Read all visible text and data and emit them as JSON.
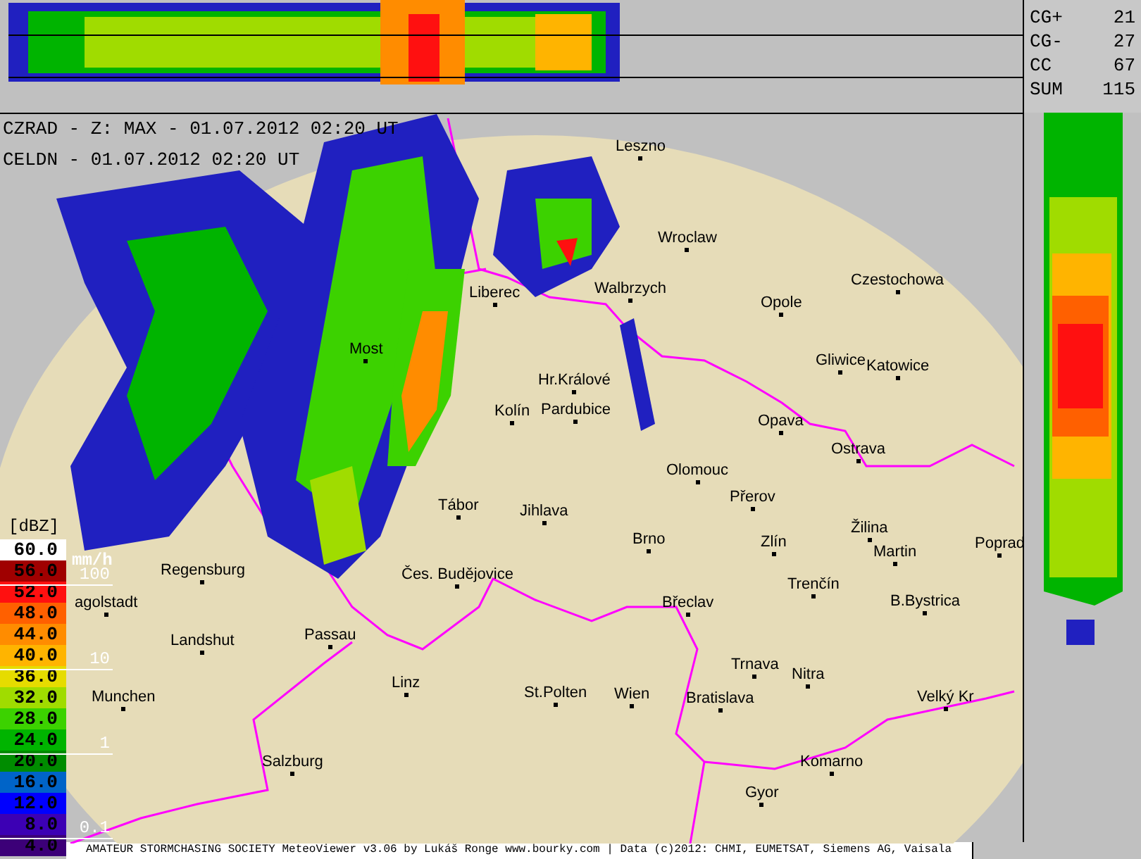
{
  "header": [
    "CZRAD - Z: MAX - 01.07.2012 02:20 UT",
    "CELDN - 01.07.2012 02:20 UT"
  ],
  "lightning_stats": [
    {
      "label": "CG+",
      "value": "21"
    },
    {
      "label": "CG-",
      "value": "27"
    },
    {
      "label": "CC",
      "value": "67"
    },
    {
      "label": "SUM",
      "value": "115"
    }
  ],
  "legend": {
    "unit": "[dBZ]",
    "rain_unit": "mm/h",
    "levels": [
      {
        "value": "60.0",
        "color": "#ffffff"
      },
      {
        "value": "56.0",
        "color": "#a00000"
      },
      {
        "value": "52.0",
        "color": "#ff1010"
      },
      {
        "value": "48.0",
        "color": "#ff6000"
      },
      {
        "value": "44.0",
        "color": "#ff8c00"
      },
      {
        "value": "40.0",
        "color": "#ffb400"
      },
      {
        "value": "36.0",
        "color": "#e6dc00"
      },
      {
        "value": "32.0",
        "color": "#a0dc00"
      },
      {
        "value": "28.0",
        "color": "#3cd200"
      },
      {
        "value": "24.0",
        "color": "#00b400"
      },
      {
        "value": "20.0",
        "color": "#008c00"
      },
      {
        "value": "16.0",
        "color": "#0064c8"
      },
      {
        "value": "12.0",
        "color": "#0000ff"
      },
      {
        "value": "8.0",
        "color": "#3c00b4"
      },
      {
        "value": "4.0",
        "color": "#3c0078"
      }
    ],
    "rain_marks": [
      "100",
      "10",
      "1",
      "0.1"
    ]
  },
  "cities": [
    "Leszno",
    "Wroclaw",
    "Czestochowa",
    "Opole",
    "Walbrzych",
    "Liberec",
    "Most",
    "Gliwice",
    "Katowice",
    "Hr.Králové",
    "Kolín",
    "Pardubice",
    "Opava",
    "Ostrava",
    "Olomouc",
    "Přerov",
    "Tábor",
    "Jihlava",
    "Brno",
    "Zlín",
    "Žilina",
    "Martin",
    "Poprad",
    "Regensburg",
    "Čes. Budějovice",
    "Trenčín",
    "agolstadt",
    "Břeclav",
    "B.Bystrica",
    "Landshut",
    "Passau",
    "Trnava",
    "Nitra",
    "Munchen",
    "Linz",
    "St.Polten",
    "Wien",
    "Bratislava",
    "Velký Kr",
    "Komarno",
    "Salzburg",
    "Gyor"
  ],
  "footer": "AMATEUR STORMCHASING SOCIETY MeteoViewer v3.06 by Lukáš Ronge www.bourky.com | Data (c)2012: CHMI, EUMETSAT, Siemens AG, Vaisala"
}
